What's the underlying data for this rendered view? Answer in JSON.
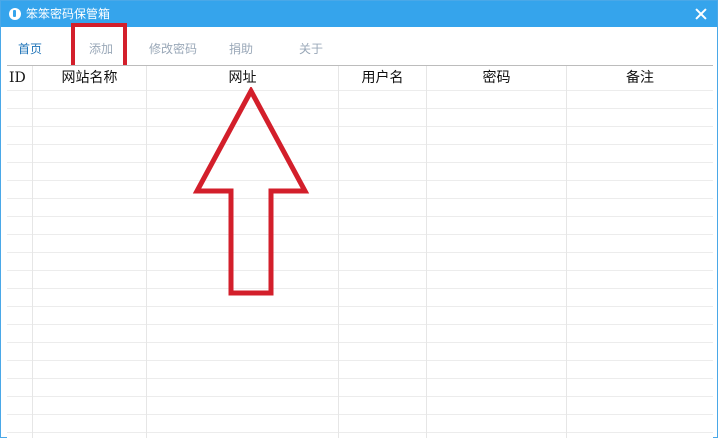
{
  "window": {
    "title": "笨笨密码保管箱",
    "accent_color": "#35a4ec",
    "close_icon": "close-icon"
  },
  "menu": {
    "items": [
      {
        "label": "首页",
        "active": true
      },
      {
        "label": "添加",
        "active": false
      },
      {
        "label": "修改密码",
        "active": false
      },
      {
        "label": "捐助",
        "active": false
      },
      {
        "label": "关于",
        "active": false
      }
    ]
  },
  "table": {
    "columns": [
      "ID",
      "网站名称",
      "网址",
      "用户名",
      "密码",
      "备注"
    ],
    "rows": []
  },
  "annotations": {
    "highlight_color": "#d31f2b",
    "arrow": "up-arrow-icon"
  }
}
